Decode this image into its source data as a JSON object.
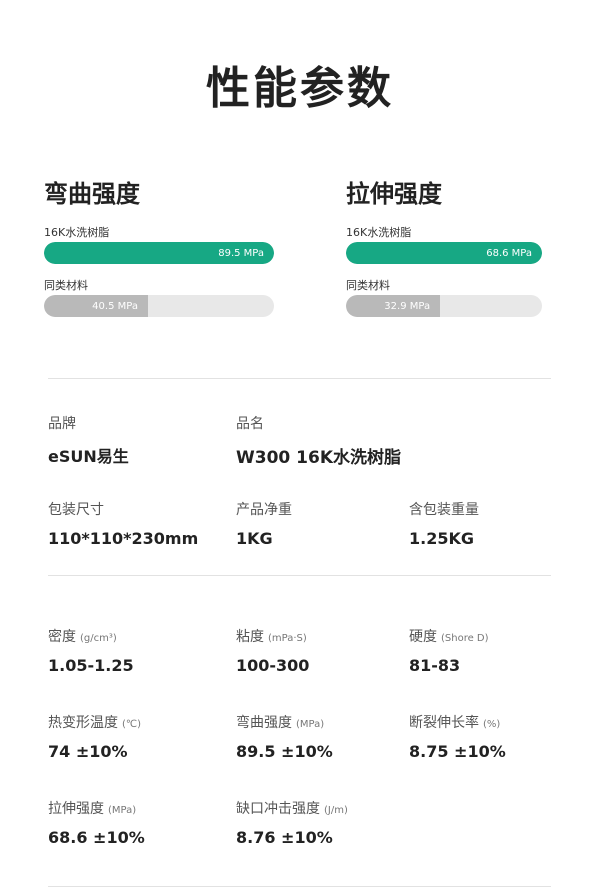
{
  "page": {
    "title": "性能参数"
  },
  "comparison": [
    {
      "title": "弯曲强度",
      "primary": {
        "label": "16K水洗树脂",
        "value": "89.5 MPa",
        "fraction": 1.0
      },
      "compare": {
        "label": "同类材料",
        "value": "40.5 MPa",
        "fraction": 0.452
      }
    },
    {
      "title": "拉伸强度",
      "primary": {
        "label": "16K水洗树脂",
        "value": "68.6 MPa",
        "fraction": 1.0
      },
      "compare": {
        "label": "同类材料",
        "value": "32.9 MPa",
        "fraction": 0.48
      }
    }
  ],
  "info": {
    "brand": {
      "label": "品牌",
      "value": "eSUN易生"
    },
    "product_name": {
      "label": "品名",
      "value": "W300 16K水洗树脂"
    },
    "package_size": {
      "label": "包装尺寸",
      "value": "110*110*230mm"
    },
    "net_weight": {
      "label": "产品净重",
      "value": "1KG"
    },
    "gross_weight": {
      "label": "含包装重量",
      "value": "1.25KG"
    }
  },
  "specs": [
    {
      "label": "密度",
      "unit": "(g/cm³)",
      "value": "1.05-1.25"
    },
    {
      "label": "粘度",
      "unit": "(mPa·S)",
      "value": "100-300"
    },
    {
      "label": "硬度",
      "unit": "(Shore D)",
      "value": "81-83"
    },
    {
      "label": "热变形温度",
      "unit": "(℃)",
      "value": "74 ±10%"
    },
    {
      "label": "弯曲强度",
      "unit": "(MPa)",
      "value": "89.5 ±10%"
    },
    {
      "label": "断裂伸长率",
      "unit": "(%)",
      "value": "8.75 ±10%"
    },
    {
      "label": "拉伸强度",
      "unit": "(MPa)",
      "value": "68.6 ±10%"
    },
    {
      "label": "缺口冲击强度",
      "unit": "(J/m)",
      "value": "8.76 ±10%"
    }
  ],
  "colors": {
    "accent": "#17a884",
    "compare_bar": "#b9b9b9",
    "track": "#e8e8e8"
  }
}
